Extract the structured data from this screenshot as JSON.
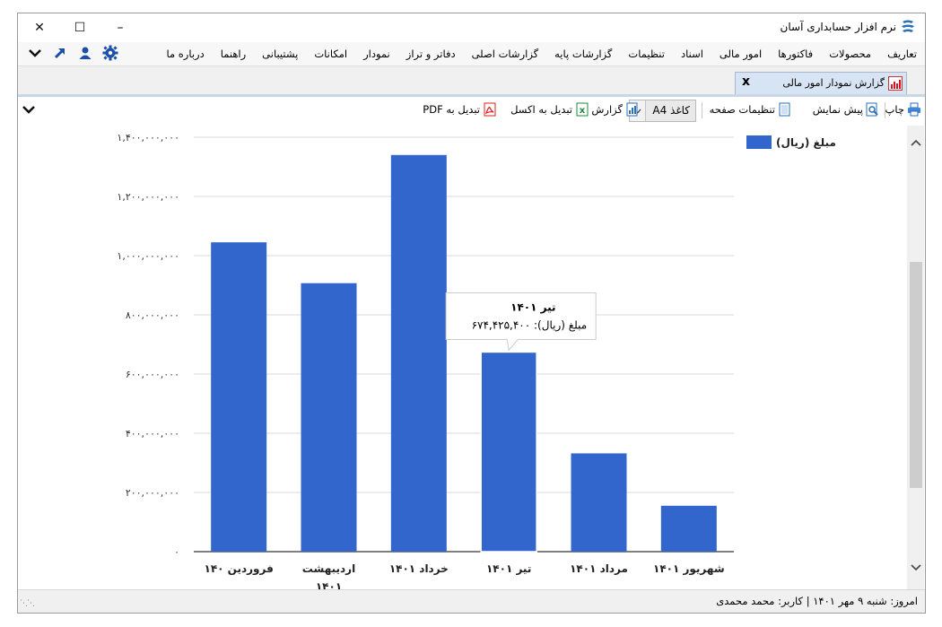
{
  "window": {
    "title": "نرم افزار حسابداری آسان",
    "minimize": "–",
    "maximize": "☐",
    "close": "✕"
  },
  "menu": {
    "items": [
      "تعاریف",
      "محصولات",
      "فاکتورها",
      "امور مالی",
      "اسناد",
      "تنظیمات",
      "گزارشات پایه",
      "گزارشات اصلی",
      "دفاتر و تراز",
      "نمودار",
      "امکانات",
      "پشتیبانی",
      "راهنما",
      "درباره ما"
    ],
    "icons": [
      "gear-icon",
      "user-icon",
      "arrow-up-right-icon",
      "chevron-down-icon"
    ]
  },
  "tab": {
    "label": "گزارش نمودار امور مالی",
    "close": "x"
  },
  "toolbar": {
    "print": "چاپ",
    "preview": "پیش نمایش",
    "page_settings": "تنظیمات صفحه",
    "paper_value": "کاغذ A4",
    "report": "گزارش",
    "to_excel": "تبدیل به اکسل",
    "to_pdf": "تبدیل به PDF"
  },
  "chart_data": {
    "type": "bar",
    "categories": [
      "فروردین ۱۴۰",
      "اردیبهشت ۱۴۰۱",
      "خرداد ۱۴۰۱",
      "تیر ۱۴۰۱",
      "مرداد ۱۴۰۱",
      "شهریور ۱۴۰۱"
    ],
    "category_lines": [
      [
        "فروردین ۱۴۰"
      ],
      [
        "اردیبهشت",
        "۱۴۰۱"
      ],
      [
        "خرداد ۱۴۰۱"
      ],
      [
        "تیر       ۱۴۰۱"
      ],
      [
        "مرداد ۱۴۰۱"
      ],
      [
        "شهریور ۱۴۰۱"
      ]
    ],
    "series": [
      {
        "name": "مبلغ (ریال)",
        "color": "#3366cc",
        "values": [
          1045000000,
          907000000,
          1340000000,
          674425400,
          332000000,
          155000000
        ]
      }
    ],
    "ylim": [
      0,
      1400000000
    ],
    "yticks": [
      0,
      200000000,
      400000000,
      600000000,
      800000000,
      1000000000,
      1200000000,
      1400000000
    ],
    "ytick_labels": [
      "۰",
      "۲۰۰,۰۰۰,۰۰۰",
      "۴۰۰,۰۰۰,۰۰۰",
      "۶۰۰,۰۰۰,۰۰۰",
      "۸۰۰,۰۰۰,۰۰۰",
      "۱,۰۰۰,۰۰۰,۰۰۰",
      "۱,۲۰۰,۰۰۰,۰۰۰",
      "۱,۴۰۰,۰۰۰,۰۰۰"
    ],
    "grid": true,
    "legend": "top-right",
    "highlight_index": 3,
    "tooltip": {
      "title": "تیر ۱۴۰۱",
      "value_text": "مبلغ (ریال): ۶۷۴,۴۲۵,۴۰۰"
    }
  },
  "status": {
    "text": "امروز: شنبه ۹ مهر ۱۴۰۱   |   کاربر: محمد محمدی"
  }
}
